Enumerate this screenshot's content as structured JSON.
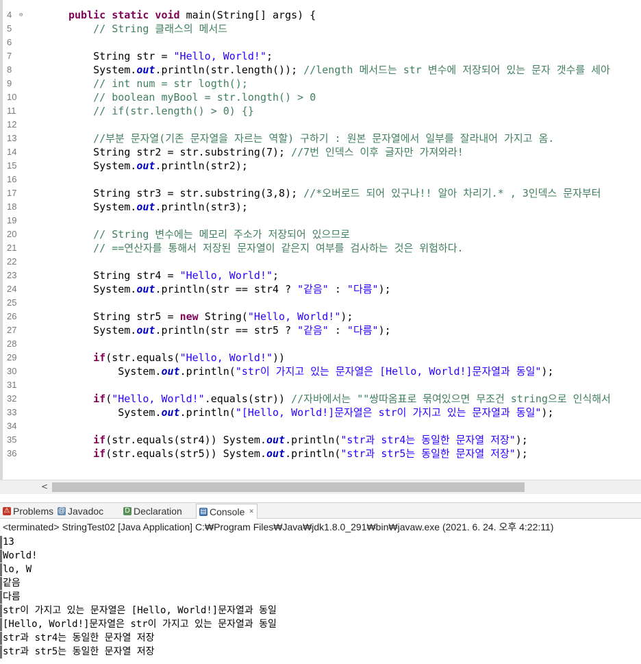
{
  "editor": {
    "lines": [
      {
        "n": "4",
        "fold": "⊖",
        "tokens": [
          {
            "c": "kw",
            "t": "public static void "
          },
          {
            "c": "plain",
            "t": "main(String[] args) {"
          }
        ]
      },
      {
        "n": "5",
        "tokens": [
          {
            "c": "cm",
            "t": "    // String 클래스의 메서드"
          }
        ]
      },
      {
        "n": "6",
        "tokens": []
      },
      {
        "n": "7",
        "tokens": [
          {
            "c": "plain",
            "t": "    String str = "
          },
          {
            "c": "st",
            "t": "\"Hello, World!\""
          },
          {
            "c": "plain",
            "t": ";"
          }
        ]
      },
      {
        "n": "8",
        "tokens": [
          {
            "c": "plain",
            "t": "    System."
          },
          {
            "c": "fld",
            "t": "out"
          },
          {
            "c": "plain",
            "t": ".println(str.length()); "
          },
          {
            "c": "cm",
            "t": "//length 메서드는 str 변수에 저장되어 있는 문자 갯수를 세아"
          }
        ]
      },
      {
        "n": "9",
        "tokens": [
          {
            "c": "cm",
            "t": "    // int num = str logth();"
          }
        ]
      },
      {
        "n": "10",
        "tokens": [
          {
            "c": "cm",
            "t": "    // boolean myBool = str.longth() > 0"
          }
        ]
      },
      {
        "n": "11",
        "tokens": [
          {
            "c": "cm",
            "t": "    // if(str.length() > 0) {}"
          }
        ]
      },
      {
        "n": "12",
        "tokens": []
      },
      {
        "n": "13",
        "tokens": [
          {
            "c": "cm",
            "t": "    //부분 문자열(기존 문자열을 자르는 역할) 구하기 : 원본 문자열에서 일부를 잘라내어 가지고 옴."
          }
        ]
      },
      {
        "n": "14",
        "tokens": [
          {
            "c": "plain",
            "t": "    String str2 = str.substring(7); "
          },
          {
            "c": "cm",
            "t": "//7번 인덱스 이후 글자만 가져와라!"
          }
        ]
      },
      {
        "n": "15",
        "tokens": [
          {
            "c": "plain",
            "t": "    System."
          },
          {
            "c": "fld",
            "t": "out"
          },
          {
            "c": "plain",
            "t": ".println(str2);"
          }
        ]
      },
      {
        "n": "16",
        "tokens": []
      },
      {
        "n": "17",
        "tokens": [
          {
            "c": "plain",
            "t": "    String str3 = str.substring(3,8); "
          },
          {
            "c": "cm",
            "t": "//*오버로드 되어 있구나!! 알아 차리기.* , 3인덱스 문자부터"
          }
        ]
      },
      {
        "n": "18",
        "tokens": [
          {
            "c": "plain",
            "t": "    System."
          },
          {
            "c": "fld",
            "t": "out"
          },
          {
            "c": "plain",
            "t": ".println(str3);"
          }
        ]
      },
      {
        "n": "19",
        "tokens": []
      },
      {
        "n": "20",
        "tokens": [
          {
            "c": "cm",
            "t": "    // String 변수에는 메모리 주소가 저장되어 있으므로"
          }
        ]
      },
      {
        "n": "21",
        "tokens": [
          {
            "c": "cm",
            "t": "    // ==연산자를 통해서 저장된 문자열이 같은지 여부를 검사하는 것은 위험하다."
          }
        ]
      },
      {
        "n": "22",
        "tokens": []
      },
      {
        "n": "23",
        "tokens": [
          {
            "c": "plain",
            "t": "    String str4 = "
          },
          {
            "c": "st",
            "t": "\"Hello, World!\""
          },
          {
            "c": "plain",
            "t": ";"
          }
        ]
      },
      {
        "n": "24",
        "tokens": [
          {
            "c": "plain",
            "t": "    System."
          },
          {
            "c": "fld",
            "t": "out"
          },
          {
            "c": "plain",
            "t": ".println(str == str4 ? "
          },
          {
            "c": "st",
            "t": "\"같음\""
          },
          {
            "c": "plain",
            "t": " : "
          },
          {
            "c": "st",
            "t": "\"다름\""
          },
          {
            "c": "plain",
            "t": ");"
          }
        ]
      },
      {
        "n": "25",
        "tokens": []
      },
      {
        "n": "26",
        "tokens": [
          {
            "c": "plain",
            "t": "    String str5 = "
          },
          {
            "c": "kw",
            "t": "new "
          },
          {
            "c": "plain",
            "t": "String("
          },
          {
            "c": "st",
            "t": "\"Hello, World!\""
          },
          {
            "c": "plain",
            "t": ");"
          }
        ]
      },
      {
        "n": "27",
        "tokens": [
          {
            "c": "plain",
            "t": "    System."
          },
          {
            "c": "fld",
            "t": "out"
          },
          {
            "c": "plain",
            "t": ".println(str == str5 ? "
          },
          {
            "c": "st",
            "t": "\"같음\""
          },
          {
            "c": "plain",
            "t": " : "
          },
          {
            "c": "st",
            "t": "\"다름\""
          },
          {
            "c": "plain",
            "t": ");"
          }
        ]
      },
      {
        "n": "28",
        "tokens": []
      },
      {
        "n": "29",
        "tokens": [
          {
            "c": "plain",
            "t": "    "
          },
          {
            "c": "kw",
            "t": "if"
          },
          {
            "c": "plain",
            "t": "(str.equals("
          },
          {
            "c": "st",
            "t": "\"Hello, World!\""
          },
          {
            "c": "plain",
            "t": "))"
          }
        ]
      },
      {
        "n": "30",
        "tokens": [
          {
            "c": "plain",
            "t": "        System."
          },
          {
            "c": "fld",
            "t": "out"
          },
          {
            "c": "plain",
            "t": ".println("
          },
          {
            "c": "st",
            "t": "\"str이 가지고 있는 문자열은 [Hello, World!]문자열과 동일\""
          },
          {
            "c": "plain",
            "t": ");"
          }
        ]
      },
      {
        "n": "31",
        "tokens": []
      },
      {
        "n": "32",
        "tokens": [
          {
            "c": "plain",
            "t": "    "
          },
          {
            "c": "kw",
            "t": "if"
          },
          {
            "c": "plain",
            "t": "("
          },
          {
            "c": "st",
            "t": "\"Hello, World!\""
          },
          {
            "c": "plain",
            "t": ".equals(str)) "
          },
          {
            "c": "cm",
            "t": "//자바에서는 \"\"쌍따옴표로 묶여있으면 무조건 string으로 인식해서"
          }
        ]
      },
      {
        "n": "33",
        "tokens": [
          {
            "c": "plain",
            "t": "        System."
          },
          {
            "c": "fld",
            "t": "out"
          },
          {
            "c": "plain",
            "t": ".println("
          },
          {
            "c": "st",
            "t": "\"[Hello, World!]문자열은 str이 가지고 있는 문자열과 동일\""
          },
          {
            "c": "plain",
            "t": ");"
          }
        ]
      },
      {
        "n": "34",
        "tokens": []
      },
      {
        "n": "35",
        "tokens": [
          {
            "c": "plain",
            "t": "    "
          },
          {
            "c": "kw",
            "t": "if"
          },
          {
            "c": "plain",
            "t": "(str.equals(str4)) System."
          },
          {
            "c": "fld",
            "t": "out"
          },
          {
            "c": "plain",
            "t": ".println("
          },
          {
            "c": "st",
            "t": "\"str과 str4는 동일한 문자열 저장\""
          },
          {
            "c": "plain",
            "t": ");"
          }
        ]
      },
      {
        "n": "36",
        "tokens": [
          {
            "c": "plain",
            "t": "    "
          },
          {
            "c": "kw",
            "t": "if"
          },
          {
            "c": "plain",
            "t": "(str.equals(str5)) System."
          },
          {
            "c": "fld",
            "t": "out"
          },
          {
            "c": "plain",
            "t": ".println("
          },
          {
            "c": "st",
            "t": "\"str과 str5는 동일한 문자열 저장\""
          },
          {
            "c": "plain",
            "t": ");"
          }
        ]
      }
    ]
  },
  "scrollbar": {
    "left_arrow": "<"
  },
  "tabs": [
    {
      "label": "Problems",
      "icon": "problems-icon",
      "icon_glyph": "⚠",
      "icon_color": "#c0392b"
    },
    {
      "label": "Javadoc",
      "icon": "javadoc-icon",
      "icon_glyph": "@",
      "icon_color": "#6a8caf"
    },
    {
      "label": "Declaration",
      "icon": "declaration-icon",
      "icon_glyph": "D",
      "icon_color": "#5a8f5a"
    },
    {
      "label": "Console",
      "icon": "console-icon",
      "icon_glyph": "▤",
      "icon_color": "#3b6ea8",
      "close": "✕"
    }
  ],
  "console": {
    "header": "<terminated> StringTest02 [Java Application] C:₩Program Files₩Java₩jdk1.8.0_291₩bin₩javaw.exe (2021. 6. 24. 오후 4:22:11)",
    "output": [
      "13",
      "World!",
      "lo, W",
      "같음",
      "다름",
      "str이 가지고 있는 문자열은 [Hello, World!]문자열과 동일",
      "[Hello, World!]문자열은 str이 가지고 있는 문자열과 동일",
      "str과 str4는 동일한 문자열 저장",
      "str과 str5는 동일한 문자열 저장"
    ]
  }
}
